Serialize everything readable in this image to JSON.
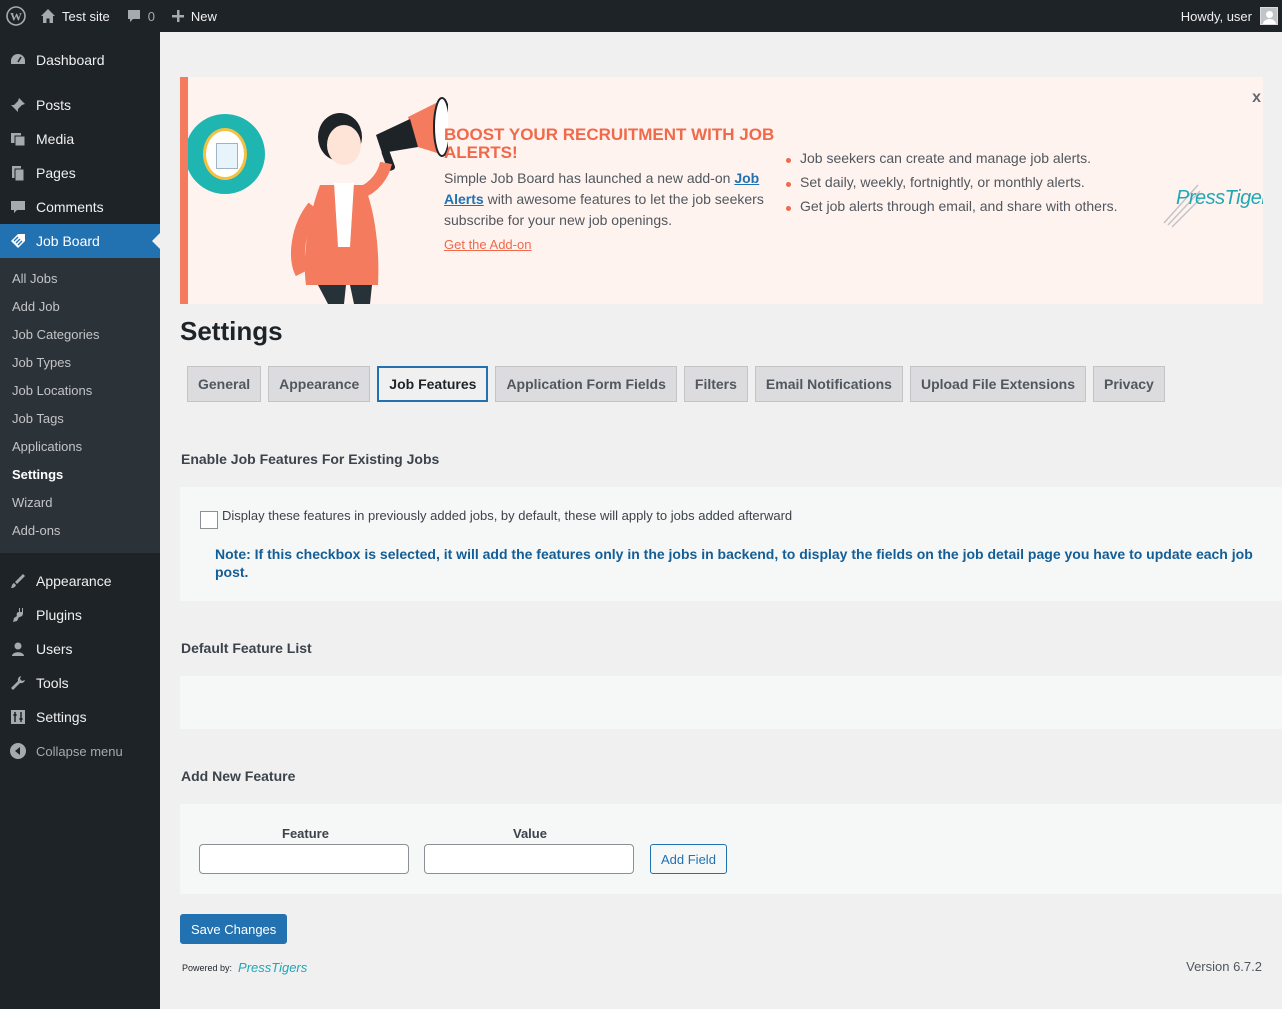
{
  "adminbar": {
    "site_name": "Test site",
    "comments_count": "0",
    "new_label": "New",
    "greeting": "Howdy, user"
  },
  "sidebar": {
    "top_items": [
      {
        "label": "Dashboard",
        "icon": "dashboard-icon"
      },
      {
        "label": "Posts",
        "icon": "pin-icon"
      },
      {
        "label": "Media",
        "icon": "media-icon"
      },
      {
        "label": "Pages",
        "icon": "pages-icon"
      },
      {
        "label": "Comments",
        "icon": "comment-icon"
      },
      {
        "label": "Job Board",
        "icon": "tag-icon"
      }
    ],
    "sub_items": [
      "All Jobs",
      "Add Job",
      "Job Categories",
      "Job Types",
      "Job Locations",
      "Job Tags",
      "Applications",
      "Settings",
      "Wizard",
      "Add-ons"
    ],
    "bottom_items": [
      {
        "label": "Appearance",
        "icon": "brush-icon"
      },
      {
        "label": "Plugins",
        "icon": "plug-icon"
      },
      {
        "label": "Users",
        "icon": "user-icon"
      },
      {
        "label": "Tools",
        "icon": "wrench-icon"
      },
      {
        "label": "Settings",
        "icon": "sliders-icon"
      }
    ],
    "collapse_label": "Collapse menu"
  },
  "banner": {
    "title": "BOOST YOUR RECRUITMENT WITH JOB ALERTS!",
    "text_before": "Simple Job Board has launched a new add-on ",
    "text_link": "Job Alerts",
    "text_after": " with awesome features to let the job seekers subscribe for your new job openings.",
    "cta": "Get the Add-on",
    "bullets": [
      "Job seekers can create and manage job alerts.",
      "Set daily, weekly, fortnightly, or monthly alerts.",
      "Get job alerts through email, and share with others."
    ],
    "logo_text": "PressTigers",
    "close": "x"
  },
  "page": {
    "title": "Settings",
    "tabs": [
      "General",
      "Appearance",
      "Job Features",
      "Application Form Fields",
      "Filters",
      "Email Notifications",
      "Upload File Extensions",
      "Privacy"
    ],
    "active_tab": "Job Features"
  },
  "existing": {
    "heading": "Enable Job Features For Existing Jobs",
    "checkbox_label": "Display these features in previously added jobs, by default, these will apply to jobs added afterward",
    "note": "Note: If this checkbox is selected, it will add the features only in the jobs in backend, to display the fields on the job detail page you have to update each job post."
  },
  "default_list": {
    "heading": "Default Feature List"
  },
  "add_new": {
    "heading": "Add New Feature",
    "feature_label": "Feature",
    "value_label": "Value",
    "button": "Add Field"
  },
  "footer": {
    "save": "Save Changes",
    "powered_by": "Powered by:",
    "powered_logo": "PressTigers",
    "version": "Version 6.7.2"
  },
  "colors": {
    "accent": "#2271b1",
    "banner_accent": "#f0694a",
    "brand_teal": "#1fa8b5"
  }
}
